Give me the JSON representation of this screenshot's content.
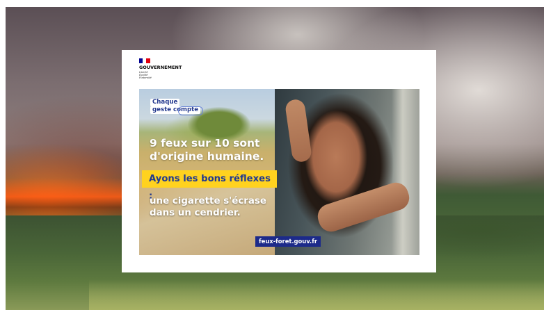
{
  "government_logo": {
    "title": "GOUVERNEMENT",
    "motto": "Liberté\nÉgalité\nFraternité",
    "flag_colors": [
      "#000091",
      "#ffffff",
      "#e1000f"
    ]
  },
  "poster": {
    "badge": {
      "line1": "Chaque",
      "line2": "geste compte"
    },
    "headline": "9 feux sur 10 sont d'origine humaine.",
    "highlight": "Ayons les bons réflexes :",
    "message": "une cigarette s'écrase dans un cendrier.",
    "url": "feux-foret.gouv.fr"
  },
  "colors": {
    "highlight_bg": "#ffd21f",
    "highlight_text": "#223a8f",
    "url_bg": "#1c2a8a",
    "badge_text": "#253a8f"
  }
}
